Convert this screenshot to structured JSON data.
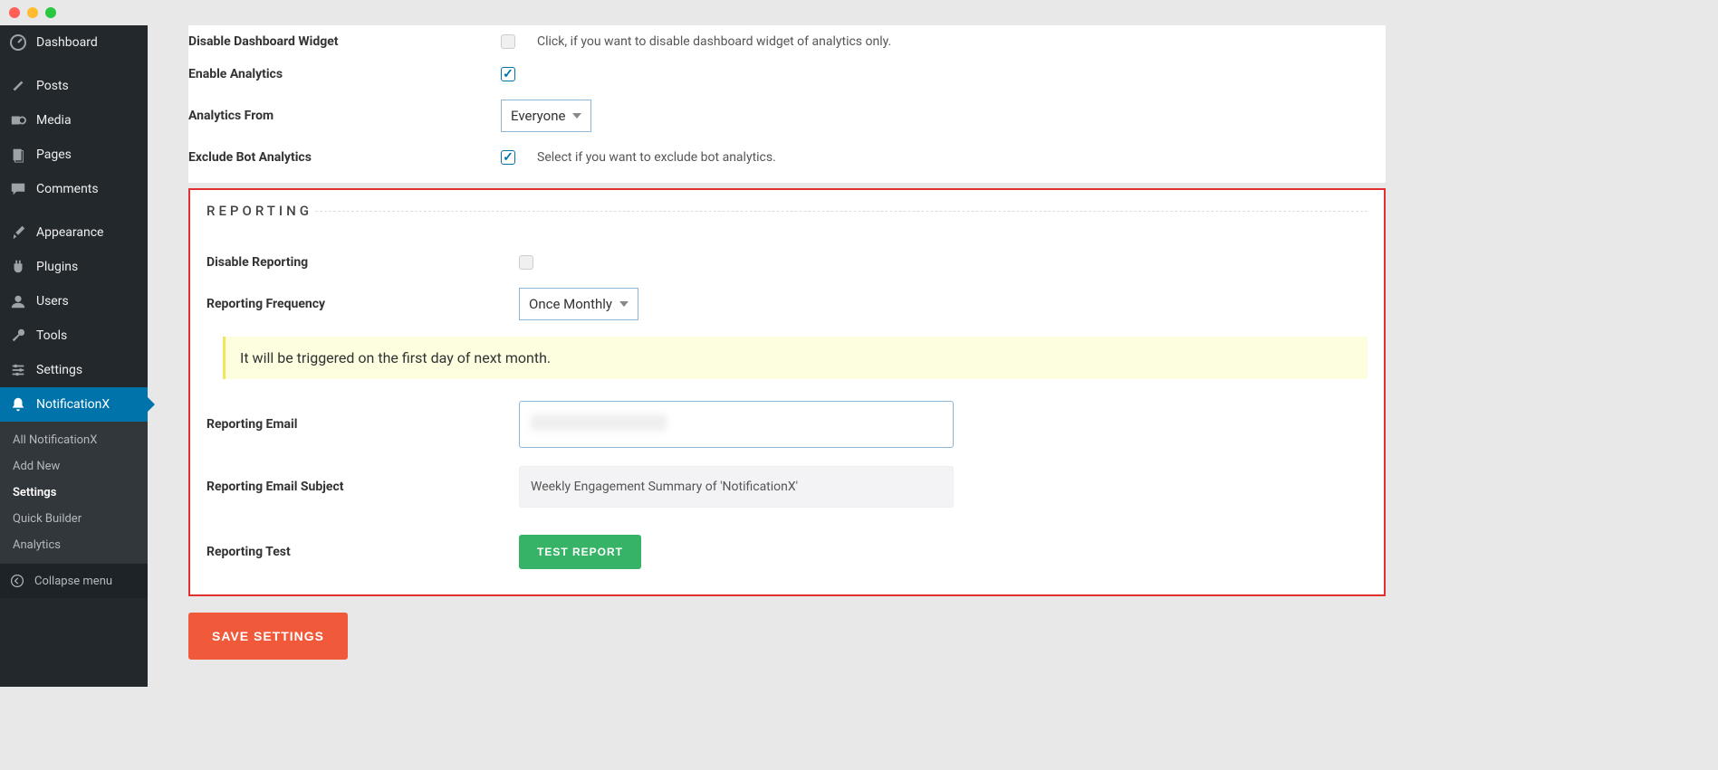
{
  "sidebar": {
    "items": [
      {
        "label": "Dashboard",
        "icon": "dashboard-icon"
      },
      {
        "label": "Posts",
        "icon": "pin-icon"
      },
      {
        "label": "Media",
        "icon": "media-icon"
      },
      {
        "label": "Pages",
        "icon": "pages-icon"
      },
      {
        "label": "Comments",
        "icon": "comments-icon"
      },
      {
        "label": "Appearance",
        "icon": "brush-icon"
      },
      {
        "label": "Plugins",
        "icon": "plug-icon"
      },
      {
        "label": "Users",
        "icon": "users-icon"
      },
      {
        "label": "Tools",
        "icon": "wrench-icon"
      },
      {
        "label": "Settings",
        "icon": "sliders-icon"
      },
      {
        "label": "NotificationX",
        "icon": "bell-icon",
        "active": true
      }
    ],
    "submenu": [
      {
        "label": "All NotificationX"
      },
      {
        "label": "Add New"
      },
      {
        "label": "Settings",
        "current": true
      },
      {
        "label": "Quick Builder"
      },
      {
        "label": "Analytics"
      }
    ],
    "collapse_label": "Collapse menu"
  },
  "analytics": {
    "disable_widget_label": "Disable Dashboard Widget",
    "disable_widget_help": "Click, if you want to disable dashboard widget of analytics only.",
    "enable_analytics_label": "Enable Analytics",
    "analytics_from_label": "Analytics From",
    "analytics_from_value": "Everyone",
    "exclude_bot_label": "Exclude Bot Analytics",
    "exclude_bot_help": "Select if you want to exclude bot analytics."
  },
  "reporting": {
    "section_title": "REPORTING",
    "disable_label": "Disable Reporting",
    "frequency_label": "Reporting Frequency",
    "frequency_value": "Once Monthly",
    "notice_text": "It will be triggered on the first day of next month.",
    "email_label": "Reporting Email",
    "email_value": "",
    "subject_label": "Reporting Email Subject",
    "subject_value": "Weekly Engagement Summary of 'NotificationX'",
    "test_label": "Reporting Test",
    "test_button": "TEST REPORT"
  },
  "save_button": "SAVE SETTINGS"
}
